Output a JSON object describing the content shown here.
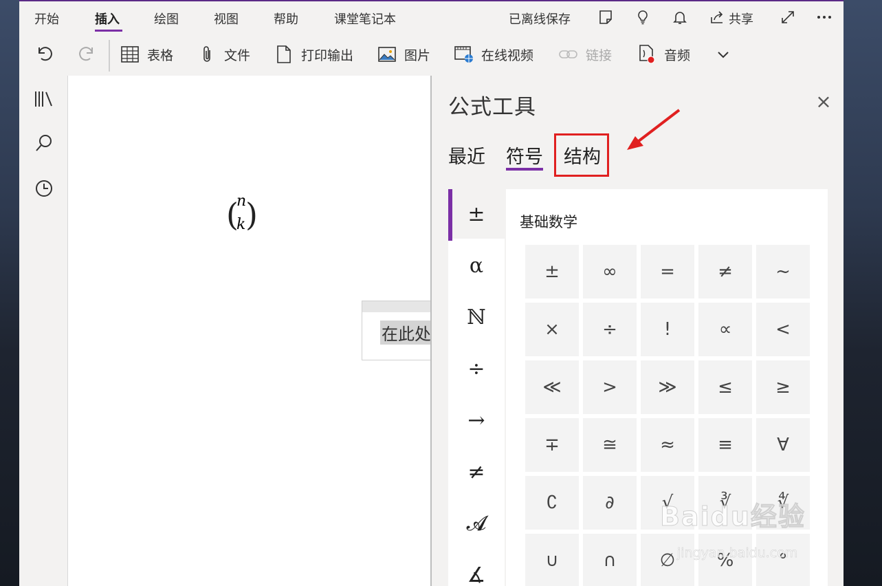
{
  "ribbon": {
    "tabs": [
      {
        "label": "开始"
      },
      {
        "label": "插入"
      },
      {
        "label": "绘图"
      },
      {
        "label": "视图"
      },
      {
        "label": "帮助"
      },
      {
        "label": "课堂笔记本"
      }
    ],
    "active_tab": "插入",
    "sync_status": "已离线保存",
    "share_label": "共享",
    "tools": [
      {
        "label": "表格",
        "icon": "table-icon"
      },
      {
        "label": "文件",
        "icon": "paperclip-icon"
      },
      {
        "label": "打印输出",
        "icon": "document-icon"
      },
      {
        "label": "图片",
        "icon": "picture-icon"
      },
      {
        "label": "在线视频",
        "icon": "online-video-icon"
      },
      {
        "label": "链接",
        "icon": "link-icon",
        "disabled": true
      },
      {
        "label": "音频",
        "icon": "audio-record-icon"
      }
    ]
  },
  "canvas": {
    "equation_top": "n",
    "equation_bottom": "k",
    "placeholder_text": "在此处"
  },
  "panel": {
    "title": "公式工具",
    "tabs": [
      {
        "label": "最近"
      },
      {
        "label": "符号"
      },
      {
        "label": "结构"
      }
    ],
    "active_tab": "符号",
    "highlighted_tab": "结构",
    "categories": [
      "±",
      "α",
      "ℕ",
      "÷",
      "→",
      "≠",
      "𝓐",
      "∡"
    ],
    "active_category": "±",
    "section_title": "基础数学",
    "symbols": [
      [
        "±",
        "∞",
        "=",
        "≠",
        "~"
      ],
      [
        "×",
        "÷",
        "!",
        "∝",
        "<"
      ],
      [
        "≪",
        ">",
        "≫",
        "≤",
        "≥"
      ],
      [
        "∓",
        "≅",
        "≈",
        "≡",
        "∀"
      ],
      [
        "∁",
        "∂",
        "√",
        "∛",
        "∜"
      ],
      [
        "∪",
        "∩",
        "∅",
        "%",
        "°"
      ]
    ]
  },
  "colors": {
    "accent": "#7b2fa6",
    "annotation_red": "#e02020"
  },
  "watermark": {
    "brand": "Baidu经验",
    "url": "jingyan.baidu.com"
  }
}
